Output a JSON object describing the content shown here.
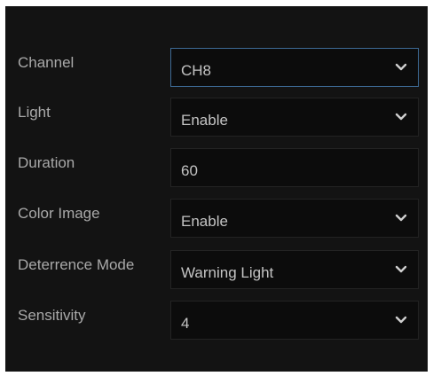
{
  "settings": {
    "channel": {
      "label": "Channel",
      "value": "CH8",
      "icon": "chevron-down-icon"
    },
    "light": {
      "label": "Light",
      "value": "Enable",
      "icon": "chevron-down-icon"
    },
    "duration": {
      "label": "Duration",
      "value": "60"
    },
    "color_image": {
      "label": "Color Image",
      "value": "Enable",
      "icon": "chevron-down-icon"
    },
    "deterrence_mode": {
      "label": "Deterrence Mode",
      "value": "Warning Light",
      "icon": "chevron-down-icon"
    },
    "sensitivity": {
      "label": "Sensitivity",
      "value": "4",
      "icon": "chevron-down-icon"
    }
  },
  "colors": {
    "panel_background": "#131313",
    "field_background": "#0c0c0c",
    "field_border": "#232323",
    "focus_border": "#3d6a95",
    "label_text": "#a9a9a9",
    "value_text": "#c4c4c4"
  }
}
